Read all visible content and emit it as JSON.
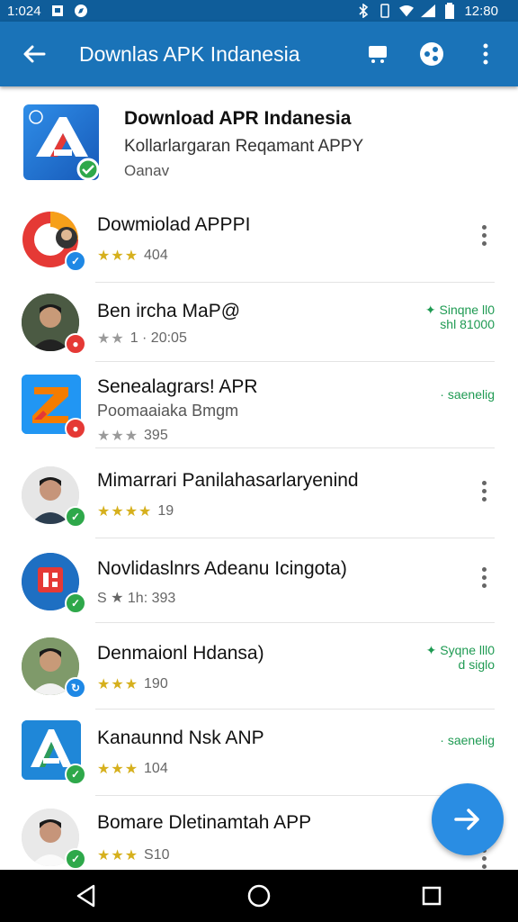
{
  "status_bar": {
    "time_left": "1:024",
    "time_right": "12:80",
    "icons": [
      "notification-icon",
      "image-icon",
      "compass-icon",
      "bluetooth-icon",
      "vibrate-icon",
      "wifi-icon",
      "signal-icon",
      "battery-icon"
    ]
  },
  "app_bar": {
    "title": "Downlas APK Indanesia",
    "icons": [
      "back-arrow-icon",
      "cart-icon",
      "share-icon",
      "overflow-menu-icon"
    ]
  },
  "header": {
    "title": "Download APR Indanesia",
    "subtitle": "Kollarlargaran Reqamant APPY",
    "developer": "Oanav"
  },
  "items": [
    {
      "title": "Dowmiolad APPPI",
      "subtitle": "",
      "stars": 3,
      "meta": "404",
      "badge": "blue-check",
      "side": "",
      "side2": "",
      "menu": true
    },
    {
      "title": "Ben ircha MaP@",
      "subtitle": "",
      "stars": 1,
      "meta": "1 · 20:05",
      "badge": "red",
      "side": "Sinqne ll0",
      "side2": "shl 81000",
      "menu": false
    },
    {
      "title": "Senealagrars! APR",
      "subtitle": "Poomaaiaka Bmgm",
      "stars": 3,
      "meta": "395",
      "badge": "red",
      "side": "· saenelig",
      "side2": "",
      "menu": false
    },
    {
      "title": "Mimarrari Panilahasarlaryenind",
      "subtitle": "",
      "stars": 4,
      "meta": "19",
      "badge": "green",
      "side": "",
      "side2": "",
      "menu": true
    },
    {
      "title": "Novlidaslnrs Adeanu Icingota)",
      "subtitle": "",
      "stars": 0,
      "meta": "S ★ 1h: 393",
      "badge": "green",
      "side": "",
      "side2": "",
      "menu": true
    },
    {
      "title": "Denmaionl Hdansa)",
      "subtitle": "",
      "stars": 3,
      "meta": "190",
      "badge": "blue",
      "side": "Syqne lll0",
      "side2": "d siglo",
      "menu": false
    },
    {
      "title": "Kanaunnd Nsk ANP",
      "subtitle": "",
      "stars": 3,
      "meta": "104",
      "badge": "green",
      "side": "· saenelig",
      "side2": "",
      "menu": false
    },
    {
      "title": "Bomare Dletinamtah APP",
      "subtitle": "",
      "stars": 3,
      "meta": "S10",
      "badge": "green",
      "side": "",
      "side2": "",
      "menu": true
    }
  ],
  "fab": {
    "icon": "arrow-right-icon"
  },
  "nav_bar": {
    "icons": [
      "back-triangle-icon",
      "home-circle-icon",
      "recents-square-icon"
    ]
  }
}
